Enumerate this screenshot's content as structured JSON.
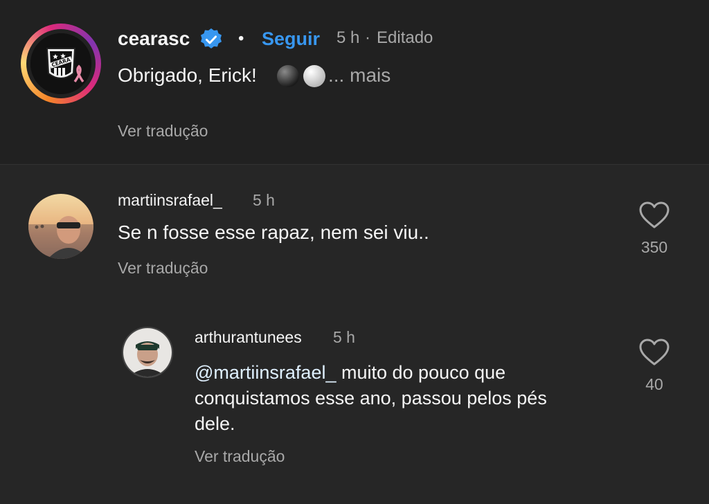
{
  "post": {
    "username": "cearasc",
    "separator": "•",
    "follow_label": "Seguir",
    "time": "5 h",
    "dot": "·",
    "edited_label": "Editado",
    "caption": "Obrigado, Erick!",
    "emoji_icons": [
      "black-circle-icon",
      "white-circle-icon"
    ],
    "more_label": "... mais",
    "translate_label": "Ver tradução",
    "avatar_text": "CEARA",
    "verified_icon": "verified-badge-icon"
  },
  "comments": [
    {
      "username": "martiinsrafael_",
      "time": "5 h",
      "text": "Se n fosse esse rapaz, nem sei viu..",
      "translate_label": "Ver tradução",
      "likes": "350"
    },
    {
      "username": "arthurantunees",
      "time": "5 h",
      "mention": "@martiinsrafael_",
      "text_line1": "muito do pouco que",
      "text_line2": "conquistamos esse ano, passou pelos pés",
      "text_line3": "dele.",
      "translate_label": "Ver tradução",
      "likes": "40"
    }
  ],
  "colors": {
    "background": "#262626",
    "accent": "#3897f0",
    "muted": "#a8a8a8"
  }
}
